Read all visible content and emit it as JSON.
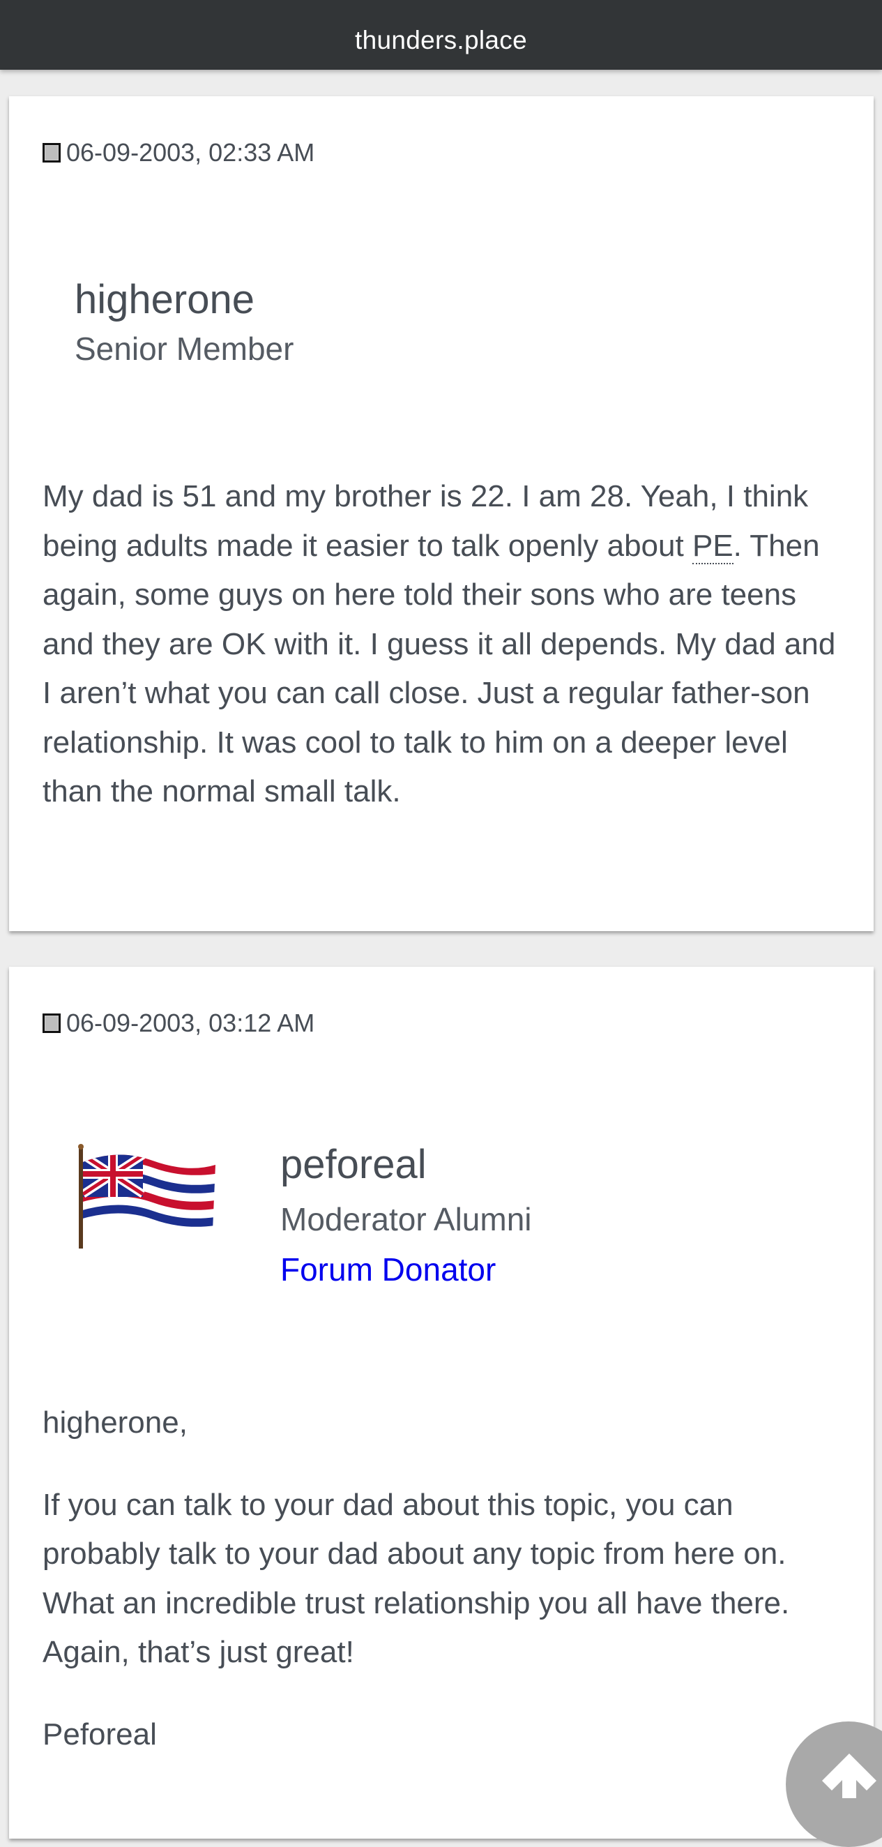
{
  "header": {
    "site_title": "thunders.place"
  },
  "posts": [
    {
      "date": "06-09-2003, 02:33 AM",
      "username": "higherone",
      "user_title": "Senior Member",
      "body_before_abbr": "My dad is 51 and my brother is 22. I am 28. Yeah, I think being adults made it easier to talk openly about ",
      "abbr": "PE",
      "body_after_abbr": ". Then again, some guys on here told their sons who are teens and they are OK with it. I guess it all depends. My dad and I aren’t what you can call close. Just a regular father-son relationship. It was cool to talk to him on a deeper level than the normal small talk."
    },
    {
      "date": "06-09-2003, 03:12 AM",
      "username": "peforeal",
      "user_title": "Moderator Alumni",
      "donator_label": "Forum Donator",
      "avatar_icon": "hawaii-flag-avatar",
      "greeting": "higherone,",
      "paragraph": "If you can talk to your dad about this topic, you can probably talk to your dad about any topic from here on. What an incredible trust relationship you all have there. Again, that’s just great!",
      "signature": "Peforeal"
    }
  ],
  "scroll_top": {
    "icon": "arrow-up-icon"
  },
  "colors": {
    "header_bg": "#323537",
    "page_bg": "#ededed",
    "text": "#474d55",
    "link": "#0000ee",
    "scroll_button": "#a9a9a9"
  }
}
